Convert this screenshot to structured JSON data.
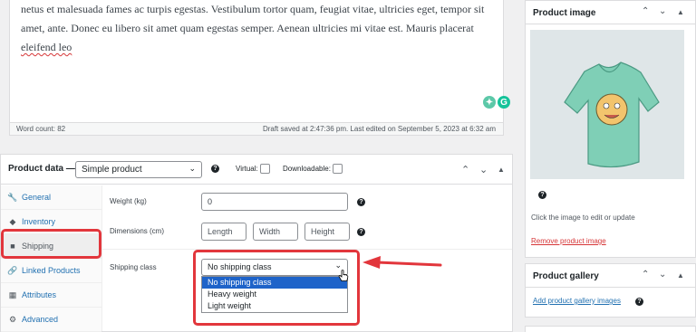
{
  "editor": {
    "lines": [
      "netus et malesuada fames ac turpis egestas. Vestibulum tortor quam, feugiat vitae, ultricies eget, tempor sit",
      "amet, ante. Donec eu libero sit amet quam egestas semper. Aenean ultricies mi vitae est. Mauris placerat",
      "eleifend leo"
    ],
    "word_count": "Word count: 82",
    "draft_saved": "Draft saved at 2:47:36 pm. Last edited on September 5, 2023 at 6:32 am"
  },
  "product_data": {
    "title": "Product data —",
    "type_value": "Simple product",
    "virtual_label": "Virtual:",
    "downloadable_label": "Downloadable:",
    "tabs": [
      {
        "label": "General",
        "icon": "wrench-icon"
      },
      {
        "label": "Inventory",
        "icon": "tag-icon"
      },
      {
        "label": "Shipping",
        "icon": "truck-icon",
        "active": true
      },
      {
        "label": "Linked Products",
        "icon": "link-icon"
      },
      {
        "label": "Attributes",
        "icon": "table-icon"
      },
      {
        "label": "Advanced",
        "icon": "gear-icon"
      }
    ],
    "weight_label": "Weight (kg)",
    "weight_value": "0",
    "dimensions_label": "Dimensions (cm)",
    "length_placeholder": "Length",
    "width_placeholder": "Width",
    "height_placeholder": "Height",
    "shipping_class_label": "Shipping class",
    "shipping_class_value": "No shipping class",
    "shipping_class_options": [
      "No shipping class",
      "Heavy weight",
      "Light weight"
    ]
  },
  "sidebar": {
    "product_image": {
      "title": "Product image",
      "hint": "Click the image to edit or update",
      "remove_link": "Remove product image"
    },
    "product_gallery": {
      "title": "Product gallery",
      "add_link": "Add product gallery images"
    }
  },
  "colors": {
    "accent": "#2271b1",
    "annotation": "#e2363c",
    "selected_option": "#1e63c9"
  }
}
